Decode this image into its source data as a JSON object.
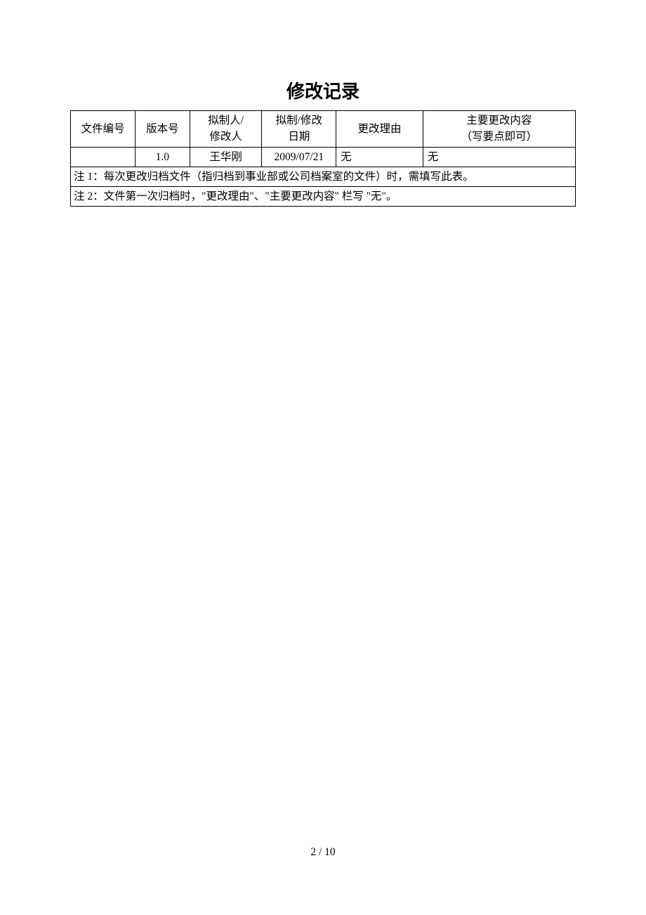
{
  "title": "修改记录",
  "headers": {
    "doc_no": "文件编号",
    "version": "版本号",
    "author_line1": "拟制人/",
    "author_line2": "修改人",
    "date_line1": "拟制/修改",
    "date_line2": "日期",
    "reason": "更改理由",
    "change_line1": "主要更改内容",
    "change_line2": "（写要点即可）"
  },
  "row1": {
    "doc_no": "",
    "version": "1.0",
    "author": "王华刚",
    "date": "2009/07/21",
    "reason": "无",
    "change": "无"
  },
  "notes": {
    "n1": "注 1：每次更改归档文件（指归档到事业部或公司档案室的文件）时，需填写此表。",
    "n2": "注 2：文件第一次归档时，\"更改理由\"、\"主要更改内容\" 栏写 \"无\"。"
  },
  "pagefoot": "2  /  10"
}
